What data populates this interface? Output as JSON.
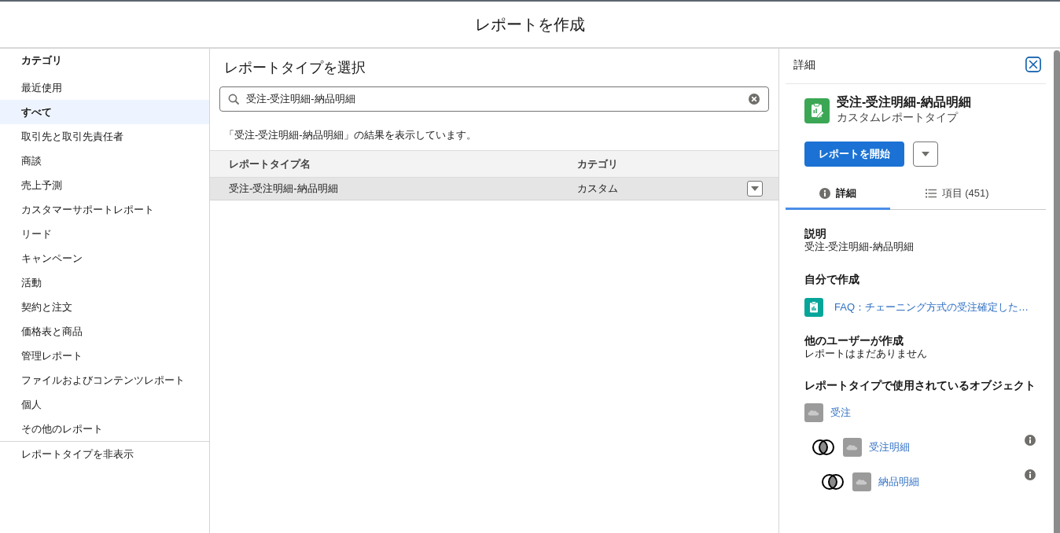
{
  "window": {
    "title": "レポートを作成"
  },
  "sidebar": {
    "heading": "カテゴリ",
    "items": [
      {
        "label": "最近使用",
        "selected": false
      },
      {
        "label": "すべて",
        "selected": true
      },
      {
        "label": "取引先と取引先責任者",
        "selected": false
      },
      {
        "label": "商談",
        "selected": false
      },
      {
        "label": "売上予測",
        "selected": false
      },
      {
        "label": "カスタマーサポートレポート",
        "selected": false
      },
      {
        "label": "リード",
        "selected": false
      },
      {
        "label": "キャンペーン",
        "selected": false
      },
      {
        "label": "活動",
        "selected": false
      },
      {
        "label": "契約と注文",
        "selected": false
      },
      {
        "label": "価格表と商品",
        "selected": false
      },
      {
        "label": "管理レポート",
        "selected": false
      },
      {
        "label": "ファイルおよびコンテンツレポート",
        "selected": false
      },
      {
        "label": "個人",
        "selected": false
      },
      {
        "label": "その他のレポート",
        "selected": false
      }
    ],
    "footer_link": "レポートタイプを非表示"
  },
  "main": {
    "title": "レポートタイプを選択",
    "search": {
      "value": "受注-受注明細-納品明細"
    },
    "result_text": "「受注-受注明細-納品明細」の結果を表示しています。",
    "table": {
      "columns": [
        "レポートタイプ名",
        "カテゴリ"
      ],
      "rows": [
        {
          "cells": [
            "受注-受注明細-納品明細",
            "カスタム"
          ],
          "selected": true
        }
      ]
    }
  },
  "details": {
    "heading": "詳細",
    "name": "受注-受注明細-納品明細",
    "subtitle": "カスタムレポートタイプ",
    "primary_button": "レポートを開始",
    "tabs": [
      {
        "label": "詳細",
        "selected": true
      },
      {
        "label": "項目 (451)",
        "selected": false
      }
    ],
    "description": {
      "label": "説明",
      "text": "受注-受注明細-納品明細"
    },
    "created_by_me": {
      "label": "自分で作成",
      "reports": [
        "FAQ：チェーニング方式の受注確定した…"
      ]
    },
    "created_by_others": {
      "label": "他のユーザーが作成",
      "text": "レポートはまだありません"
    },
    "objects": {
      "label": "レポートタイプで使用されているオブジェクト",
      "tree": [
        {
          "name": "受注",
          "children": [
            {
              "name": "受注明細",
              "children": [
                {
                  "name": "納品明細"
                }
              ]
            }
          ]
        }
      ]
    }
  }
}
